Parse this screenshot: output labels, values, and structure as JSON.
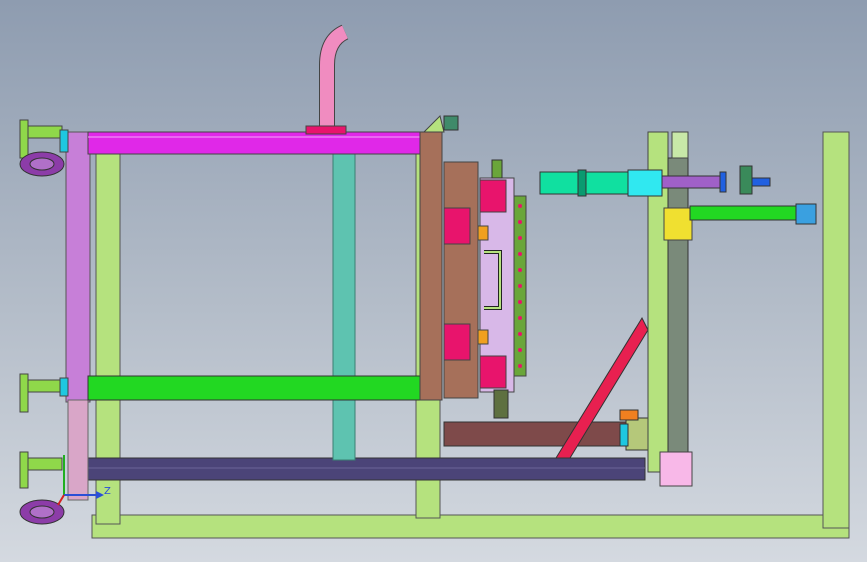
{
  "viewport": {
    "background_top": "#8e9cb0",
    "background_bottom": "#d4d9e0"
  },
  "triad": {
    "x_label": "",
    "y_label": "",
    "z_label": "Z",
    "x_color": "#d62020",
    "y_color": "#20b020",
    "z_color": "#2a4fd6"
  },
  "colors": {
    "frame_green": "#b5e27e",
    "magenta": "#e028e8",
    "bright_green": "#22d822",
    "teal": "#5ec3b0",
    "navy": "#4b4478",
    "brown": "#a6705a",
    "hot_pink": "#e8146c",
    "pink_pipe": "#f08cc0",
    "cyan_cylinder": "#10e0a0",
    "purple": "#8c3ca8"
  }
}
